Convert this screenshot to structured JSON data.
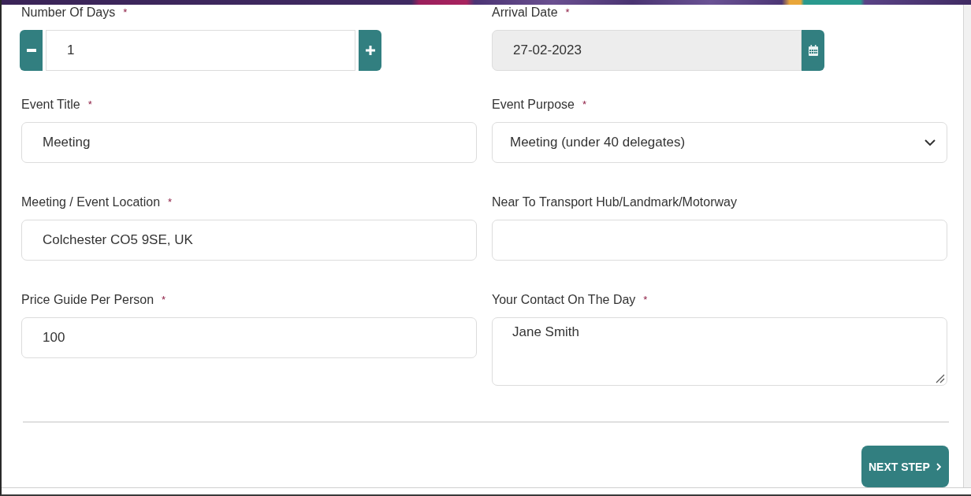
{
  "form": {
    "fields": [
      {
        "kind": "stepper",
        "label": "Number Of Days",
        "required_mark": "*",
        "value": "1"
      },
      {
        "kind": "date",
        "label": "Arrival Date",
        "required_mark": "*",
        "value": "27-02-2023",
        "disabled": true
      },
      {
        "kind": "text",
        "label": "Event Title",
        "required_mark": "*",
        "value": "Meeting"
      },
      {
        "kind": "select",
        "label": "Event Purpose",
        "required_mark": "*",
        "value": "Meeting (under 40 delegates)"
      },
      {
        "kind": "text",
        "label": "Meeting / Event Location",
        "required_mark": "*",
        "value": "Colchester CO5 9SE, UK"
      },
      {
        "kind": "text",
        "label": "Near To Transport Hub/Landmark/Motorway"
      },
      {
        "kind": "text",
        "label": "Price Guide Per Person",
        "required_mark": "*",
        "value": "100"
      },
      {
        "kind": "textarea",
        "label": "Your Contact On The Day",
        "required_mark": "*",
        "value": "Jane Smith"
      }
    ]
  },
  "next_button": {
    "label": "NEXT STEP"
  }
}
